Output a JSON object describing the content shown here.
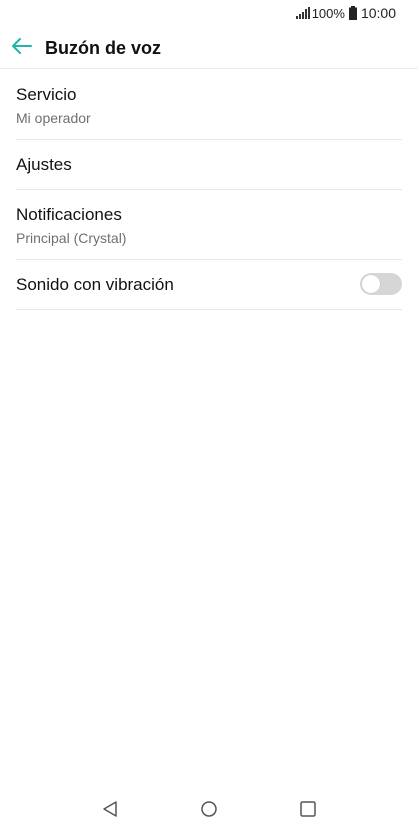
{
  "status_bar": {
    "battery_percent": "100%",
    "time": "10:00",
    "icons": [
      "signal-icon",
      "battery-icon"
    ]
  },
  "header": {
    "title": "Buzón de voz",
    "back_icon": "back-arrow-icon",
    "accent_color": "#1fb5ad"
  },
  "settings": [
    {
      "title": "Servicio",
      "subtitle": "Mi operador"
    },
    {
      "title": "Ajustes"
    },
    {
      "title": "Notificaciones",
      "subtitle": "Principal (Crystal)"
    },
    {
      "title": "Sonido con vibración",
      "toggle_on": false
    }
  ],
  "nav_bar": {
    "icons": [
      "back-triangle-icon",
      "home-circle-icon",
      "recents-square-icon"
    ]
  }
}
